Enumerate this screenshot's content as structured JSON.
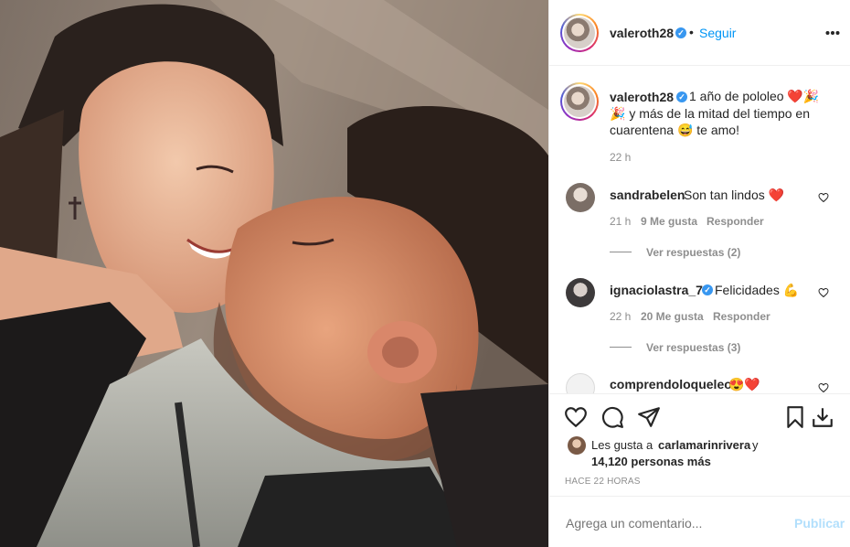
{
  "post": {
    "author": "valeroth28",
    "verified_mark": "✓",
    "follow_label": "Seguir",
    "more_icon": "more-horizontal-icon",
    "caption": {
      "user": "valeroth28",
      "line1": "1 año de pololeo ❤️🎉",
      "line2": "🎉 y más de la mitad del tiempo en",
      "line3": "cuarentena 😅 te amo!",
      "time": "22 h"
    },
    "comments": [
      {
        "user": "sandrabelen",
        "text": "Son tan lindos ❤️",
        "time": "21 h",
        "likes": "9 Me gusta",
        "reply": "Responder",
        "view_replies": "Ver respuestas (2)",
        "verified": false
      },
      {
        "user": "ignaciolastra_7",
        "text": "Felicidades 💪",
        "time": "22 h",
        "likes": "20 Me gusta",
        "reply": "Responder",
        "view_replies": "Ver respuestas (3)",
        "verified": true
      },
      {
        "user": "comprendoloqueleo",
        "text": "😍❤️",
        "verified": false
      }
    ],
    "likes_line1_prefix": "Les gusta a",
    "likes_user": "carlamarinrivera",
    "likes_line1_suffix": "y",
    "likes_line2": "14,120 personas más",
    "timestamp": "HACE 22 HORAS",
    "comment_placeholder": "Agrega un comentario...",
    "publish_label": "Publicar"
  }
}
